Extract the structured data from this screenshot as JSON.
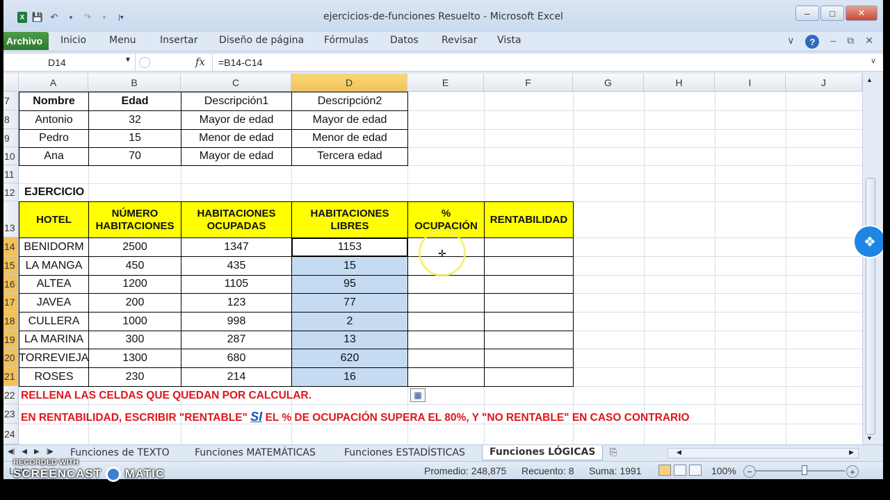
{
  "window": {
    "title": "ejercicios-de-funciones Resuelto  -  Microsoft Excel",
    "minimize": "–",
    "maximize": "□",
    "close": "✕"
  },
  "ribbon": {
    "tabs": [
      "Archivo",
      "Inicio",
      "Menu",
      "Insertar",
      "Diseño de página",
      "Fórmulas",
      "Datos",
      "Revisar",
      "Vista"
    ]
  },
  "formula_bar": {
    "name_box": "D14",
    "fx": "fx",
    "formula": "=B14-C14"
  },
  "columns": [
    "A",
    "B",
    "C",
    "D",
    "E",
    "F",
    "G",
    "H",
    "I",
    "J"
  ],
  "rows": [
    "7",
    "8",
    "9",
    "10",
    "11",
    "12",
    "13",
    "14",
    "15",
    "16",
    "17",
    "18",
    "19",
    "20",
    "21",
    "22",
    "23",
    "24"
  ],
  "table1": {
    "headers": [
      "Nombre",
      "Edad",
      "Descripción1",
      "Descripción2"
    ],
    "rows": [
      [
        "Antonio",
        "32",
        "Mayor de edad",
        "Mayor de edad"
      ],
      [
        "Pedro",
        "15",
        "Menor de edad",
        "Menor de edad"
      ],
      [
        "Ana",
        "70",
        "Mayor de edad",
        "Tercera edad"
      ]
    ]
  },
  "ejercicio_label": "EJERCICIO",
  "table2": {
    "headers": [
      "HOTEL",
      "NÚMERO HABITACIONES",
      "HABITACIONES OCUPADAS",
      "HABITACIONES LIBRES",
      "% OCUPACIÓN",
      "RENTABILIDAD"
    ],
    "rows": [
      [
        "BENIDORM",
        "2500",
        "1347",
        "1153",
        "",
        ""
      ],
      [
        "LA MANGA",
        "450",
        "435",
        "15",
        "",
        ""
      ],
      [
        "ALTEA",
        "1200",
        "1105",
        "95",
        "",
        ""
      ],
      [
        "JAVEA",
        "200",
        "123",
        "77",
        "",
        ""
      ],
      [
        "CULLERA",
        "1000",
        "998",
        "2",
        "",
        ""
      ],
      [
        "LA MARINA",
        "300",
        "287",
        "13",
        "",
        ""
      ],
      [
        "TORREVIEJA",
        "1300",
        "680",
        "620",
        "",
        ""
      ],
      [
        "ROSES",
        "230",
        "214",
        "16",
        "",
        ""
      ]
    ]
  },
  "instructions": {
    "line1": "RELLENA LAS CELDAS QUE QUEDAN POR CALCULAR.",
    "line2_a": "EN RENTABILIDAD, ESCRIBIR \"RENTABLE\"",
    "line2_si": "SI",
    "line2_b": "EL % DE OCUPACIÓN SUPERA EL 80%, Y \"NO RENTABLE\" EN CASO CONTRARIO"
  },
  "sheet_tabs": [
    "Funciones de TEXTO",
    "Funciones MATEMÁTICAS",
    "Funciones ESTADÍSTICAS",
    "Funciones LÓGICAS"
  ],
  "active_sheet": "Funciones LÓGICAS",
  "status": {
    "ready": "Listo",
    "promedio": "Promedio: 248,875",
    "recuento": "Recuento: 8",
    "suma": "Suma: 1991",
    "zoom": "100%"
  },
  "watermark": {
    "line1": "RECORDED WITH",
    "line2": "SCREENCAST",
    "line3": "MATIC"
  },
  "colors": {
    "header_yellow": "#ffff00",
    "selection_blue": "#c5dbf2",
    "instruction_red": "#e0151b",
    "archivo_green": "#2c7a2c"
  }
}
